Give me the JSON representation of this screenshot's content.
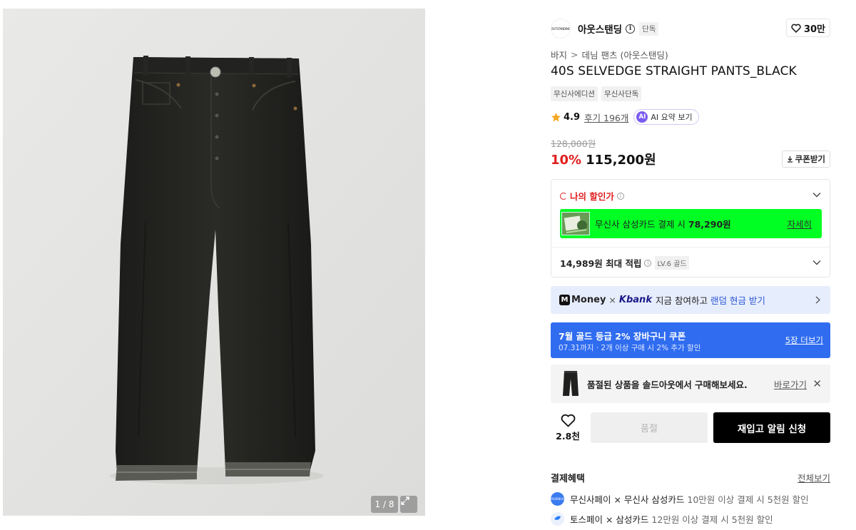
{
  "gallery": {
    "counter": "1 / 8",
    "expand_icon": "expand-icon"
  },
  "brand": {
    "logo_text": "OUTSTANDING",
    "name": "아웃스탠딩",
    "info_icon": "info-icon",
    "tag": "단독",
    "likes": "30만"
  },
  "breadcrumb": {
    "level1": "바지",
    "separator": ">",
    "level2": "데님 팬츠 (아웃스탠딩)"
  },
  "product": {
    "title": "40S SELVEDGE STRAIGHT PANTS_BLACK",
    "tags": [
      "무신사에디션",
      "무신사단독"
    ]
  },
  "rating": {
    "score": "4.9",
    "reviews": "후기 196개",
    "ai_badge": "AI",
    "ai_label": "AI 요약 보기",
    "star_color": "#f5a623"
  },
  "price": {
    "original": "128,000원",
    "discount": "10%",
    "final": "115,200원",
    "coupon_label": "쿠폰받기",
    "discount_color": "#e02020"
  },
  "benefits": {
    "my_price_label": "나의 할인가",
    "card_prefix": "무신사 삼성카드 결제 시",
    "card_price": "78,290원",
    "card_more": "자세히",
    "card_bg": "#00ff22",
    "points_label": "14,989원 최대 적립",
    "level": "LV.6 골드"
  },
  "kbank_banner": {
    "money": "Money",
    "m": "M",
    "x": "×",
    "kbank": "Kbank",
    "text": "지금 참여하고",
    "highlight": "랜덤 현금 받기"
  },
  "gold_banner": {
    "title": "7월 골드 등급 2% 장바구니 쿠폰",
    "subtitle": "07.31까지 · 2개 이상 구매 시 2% 추가 할인",
    "link": "5장 더보기",
    "bg": "#2f6cf0"
  },
  "soldout_banner": {
    "text": "품절된 상품을 솔드아웃에서 구매해보세요.",
    "link": "바로가기",
    "close": "✕"
  },
  "actions": {
    "wish_count": "2.8천",
    "soldout": "품절",
    "restock": "재입고 알림 신청"
  },
  "payment": {
    "title": "결제혜택",
    "view_all": "전체보기",
    "rows": [
      {
        "name": "무신사페이 × 무신사 삼성카드",
        "note": "10만원 이상 결제 시 5천원 할인",
        "icon": "musinsa-pay-icon"
      },
      {
        "name": "토스페이 × 삼성카드",
        "note": "12만원 이상 결제 시 5천원 할인",
        "icon": "toss-pay-icon"
      }
    ]
  }
}
